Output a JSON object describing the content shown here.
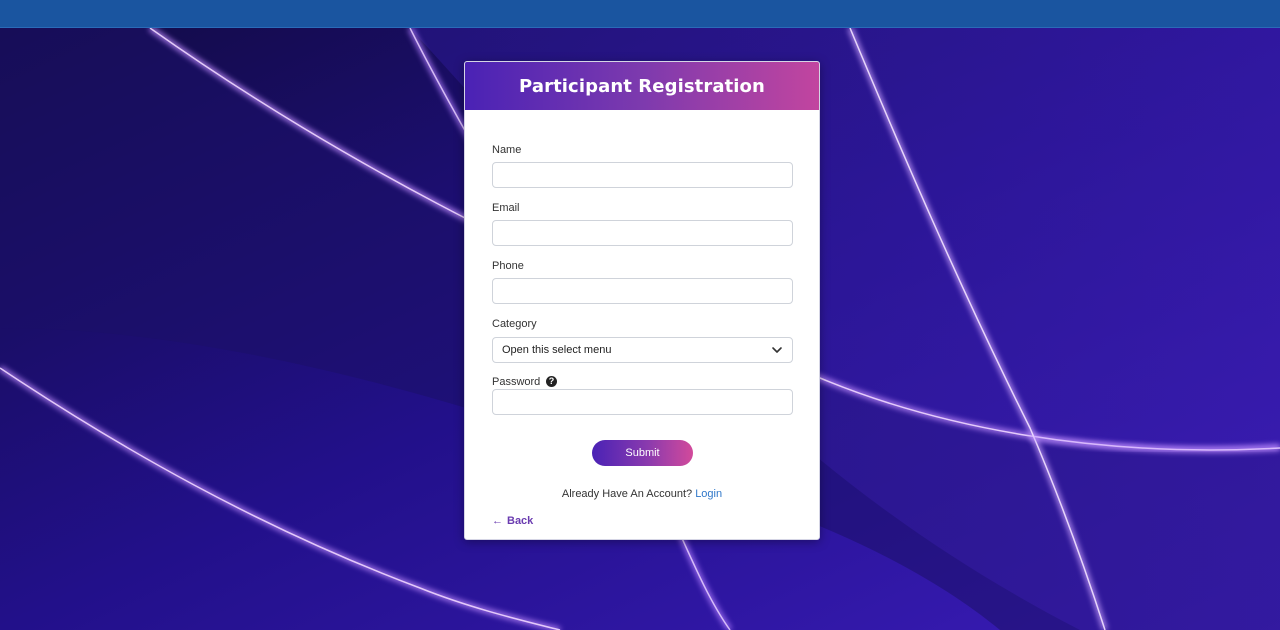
{
  "form": {
    "title": "Participant Registration",
    "fields": {
      "name": {
        "label": "Name",
        "value": "",
        "placeholder": ""
      },
      "email": {
        "label": "Email",
        "value": "",
        "placeholder": ""
      },
      "phone": {
        "label": "Phone",
        "value": "",
        "placeholder": ""
      },
      "category": {
        "label": "Category",
        "selected": "Open this select menu"
      },
      "password": {
        "label": "Password",
        "value": "",
        "placeholder": ""
      }
    },
    "submit_label": "Submit",
    "account_prompt": "Already Have An Account?",
    "login_label": "Login",
    "back_label": "Back"
  },
  "icons": {
    "help": "question-circle-icon",
    "chevron": "chevron-down-icon",
    "back": "arrow-left-icon"
  },
  "colors": {
    "topbar": "#1a55a0",
    "header_gradient_start": "#4a22b5",
    "header_gradient_end": "#c2459f",
    "link": "#2f77c9",
    "back": "#6a3bb0"
  }
}
